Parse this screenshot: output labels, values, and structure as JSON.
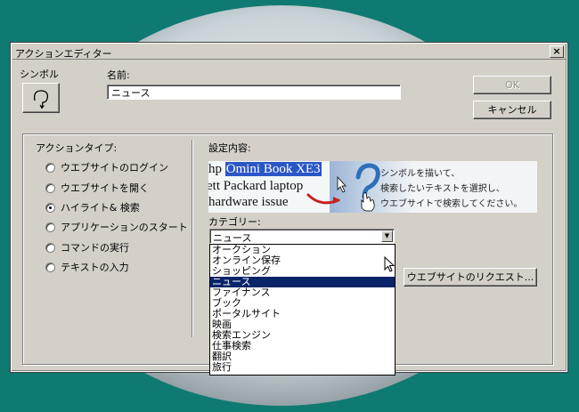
{
  "window": {
    "title": "アクションエディター",
    "close": "×"
  },
  "symbol": {
    "label": "シンボル",
    "glyph": "↩"
  },
  "name": {
    "label": "名前:",
    "value": "ニュース"
  },
  "buttons": {
    "ok": "OK",
    "cancel": "キャンセル",
    "request": "ウエブサイトのリクエスト..."
  },
  "action_type": {
    "label": "アクションタイプ:",
    "options": [
      {
        "label": "ウエブサイトのログイン",
        "checked": false
      },
      {
        "label": "ウエブサイトを開く",
        "checked": false
      },
      {
        "label": "ハイライト& 検索",
        "checked": true
      },
      {
        "label": "アプリケーションのスタート",
        "checked": false
      },
      {
        "label": "コマンドの実行",
        "checked": false
      },
      {
        "label": "テキストの入力",
        "checked": false
      }
    ]
  },
  "settings": {
    "label": "設定内容:",
    "preview": {
      "line1_pre": "hp ",
      "line1_highlight": "Omini Book XE3",
      "line2": "ett Packard laptop",
      "line3": "hardware issue",
      "message": [
        "シンボルを描いて、",
        "検索したいテキストを選択し、",
        "ウエブサイトで検索してください。"
      ]
    }
  },
  "category": {
    "label": "カテゴリー:",
    "selected": "ニュース",
    "arrow": "▼",
    "options": [
      "オークション",
      "オンライン保存",
      "ショッピング",
      "ニュース",
      "ファイナンス",
      "ブック",
      "ポータルサイト",
      "映画",
      "検索エンジン",
      "仕事検索",
      "翻訳",
      "旅行"
    ]
  },
  "colors": {
    "desktop": "#0f7a72",
    "dialog": "#d4d0c8",
    "selection": "#0a246a",
    "preview_highlight": "#2a56c6"
  }
}
